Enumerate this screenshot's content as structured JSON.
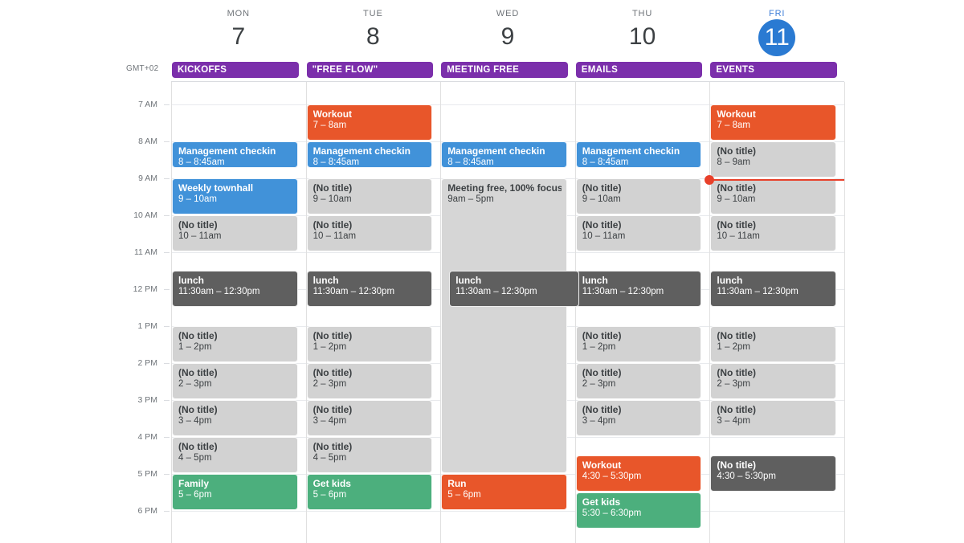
{
  "meta": {
    "timezone_label": "GMT+02",
    "accent_today": "#2a7ad2",
    "allday_chip_color": "#7b2fab",
    "now_indicator_color": "#e8402a"
  },
  "days": [
    {
      "dow": "MON",
      "num": "7",
      "today": false,
      "allday": "KICKOFFS"
    },
    {
      "dow": "TUE",
      "num": "8",
      "today": false,
      "allday": "\"FREE FLOW\""
    },
    {
      "dow": "WED",
      "num": "9",
      "today": false,
      "allday": "MEETING FREE"
    },
    {
      "dow": "THU",
      "num": "10",
      "today": false,
      "allday": "EMAILS"
    },
    {
      "dow": "FRI",
      "num": "11",
      "today": true,
      "allday": "EVENTS"
    }
  ],
  "time_axis": {
    "labels": [
      "7 AM",
      "8 AM",
      "9 AM",
      "10 AM",
      "11 AM",
      "12 PM",
      "1 PM",
      "2 PM",
      "3 PM",
      "4 PM",
      "5 PM",
      "6 PM"
    ]
  },
  "events": [
    {
      "day": 0,
      "title": "Management checkin",
      "time": "8 – 8:45am",
      "color": "blue",
      "start": 8.0,
      "end": 8.75
    },
    {
      "day": 0,
      "title": "Weekly townhall",
      "time": "9 – 10am",
      "color": "blue",
      "start": 9.0,
      "end": 10.0
    },
    {
      "day": 0,
      "title": "(No title)",
      "time": "10 – 11am",
      "color": "gray",
      "start": 10.0,
      "end": 11.0
    },
    {
      "day": 0,
      "title": "lunch",
      "time": "11:30am – 12:30pm",
      "color": "darkgray",
      "start": 11.5,
      "end": 12.5
    },
    {
      "day": 0,
      "title": "(No title)",
      "time": "1 – 2pm",
      "color": "gray",
      "start": 13.0,
      "end": 14.0
    },
    {
      "day": 0,
      "title": "(No title)",
      "time": "2 – 3pm",
      "color": "gray",
      "start": 14.0,
      "end": 15.0
    },
    {
      "day": 0,
      "title": "(No title)",
      "time": "3 – 4pm",
      "color": "gray",
      "start": 15.0,
      "end": 16.0
    },
    {
      "day": 0,
      "title": "(No title)",
      "time": "4 – 5pm",
      "color": "gray",
      "start": 16.0,
      "end": 17.0
    },
    {
      "day": 0,
      "title": "Family",
      "time": "5 – 6pm",
      "color": "green",
      "start": 17.0,
      "end": 18.0
    },
    {
      "day": 1,
      "title": "Workout",
      "time": "7 – 8am",
      "color": "orange",
      "start": 7.0,
      "end": 8.0
    },
    {
      "day": 1,
      "title": "Management checkin",
      "time": "8 – 8:45am",
      "color": "blue",
      "start": 8.0,
      "end": 8.75
    },
    {
      "day": 1,
      "title": "(No title)",
      "time": "9 – 10am",
      "color": "gray",
      "start": 9.0,
      "end": 10.0
    },
    {
      "day": 1,
      "title": "(No title)",
      "time": "10 – 11am",
      "color": "gray",
      "start": 10.0,
      "end": 11.0
    },
    {
      "day": 1,
      "title": "lunch",
      "time": "11:30am – 12:30pm",
      "color": "darkgray",
      "start": 11.5,
      "end": 12.5
    },
    {
      "day": 1,
      "title": "(No title)",
      "time": "1 – 2pm",
      "color": "gray",
      "start": 13.0,
      "end": 14.0
    },
    {
      "day": 1,
      "title": "(No title)",
      "time": "2 – 3pm",
      "color": "gray",
      "start": 14.0,
      "end": 15.0
    },
    {
      "day": 1,
      "title": "(No title)",
      "time": "3 – 4pm",
      "color": "gray",
      "start": 15.0,
      "end": 16.0
    },
    {
      "day": 1,
      "title": "(No title)",
      "time": "4 – 5pm",
      "color": "gray",
      "start": 16.0,
      "end": 17.0
    },
    {
      "day": 1,
      "title": "Get kids",
      "time": "5 – 6pm",
      "color": "green",
      "start": 17.0,
      "end": 18.0
    },
    {
      "day": 2,
      "title": "Management checkin",
      "time": "8 – 8:45am",
      "color": "blue",
      "start": 8.0,
      "end": 8.75
    },
    {
      "day": 2,
      "title": "Meeting free, 100% focus",
      "time": "9am – 5pm",
      "color": "lightgray",
      "start": 9.0,
      "end": 17.0
    },
    {
      "day": 2,
      "title": "lunch",
      "time": "11:30am – 12:30pm",
      "color": "darkgray",
      "start": 11.5,
      "end": 12.5,
      "indent": true
    },
    {
      "day": 2,
      "title": "Run",
      "time": "5 – 6pm",
      "color": "orange",
      "start": 17.0,
      "end": 18.0
    },
    {
      "day": 3,
      "title": "Management checkin",
      "time": "8 – 8:45am",
      "color": "blue",
      "start": 8.0,
      "end": 8.75
    },
    {
      "day": 3,
      "title": "(No title)",
      "time": "9 – 10am",
      "color": "gray",
      "start": 9.0,
      "end": 10.0
    },
    {
      "day": 3,
      "title": "(No title)",
      "time": "10 – 11am",
      "color": "gray",
      "start": 10.0,
      "end": 11.0
    },
    {
      "day": 3,
      "title": "lunch",
      "time": "11:30am – 12:30pm",
      "color": "darkgray",
      "start": 11.5,
      "end": 12.5
    },
    {
      "day": 3,
      "title": "(No title)",
      "time": "1 – 2pm",
      "color": "gray",
      "start": 13.0,
      "end": 14.0
    },
    {
      "day": 3,
      "title": "(No title)",
      "time": "2 – 3pm",
      "color": "gray",
      "start": 14.0,
      "end": 15.0
    },
    {
      "day": 3,
      "title": "(No title)",
      "time": "3 – 4pm",
      "color": "gray",
      "start": 15.0,
      "end": 16.0
    },
    {
      "day": 3,
      "title": "Workout",
      "time": "4:30 – 5:30pm",
      "color": "orange",
      "start": 16.5,
      "end": 17.5
    },
    {
      "day": 3,
      "title": "Get kids",
      "time": "5:30 – 6:30pm",
      "color": "green",
      "start": 17.5,
      "end": 18.5
    },
    {
      "day": 4,
      "title": "Workout",
      "time": "7 – 8am",
      "color": "orange",
      "start": 7.0,
      "end": 8.0
    },
    {
      "day": 4,
      "title": "(No title)",
      "time": "8 – 9am",
      "color": "gray",
      "start": 8.0,
      "end": 9.0
    },
    {
      "day": 4,
      "title": "(No title)",
      "time": "9 – 10am",
      "color": "gray",
      "start": 9.0,
      "end": 10.0
    },
    {
      "day": 4,
      "title": "(No title)",
      "time": "10 – 11am",
      "color": "gray",
      "start": 10.0,
      "end": 11.0
    },
    {
      "day": 4,
      "title": "lunch",
      "time": "11:30am – 12:30pm",
      "color": "darkgray",
      "start": 11.5,
      "end": 12.5
    },
    {
      "day": 4,
      "title": "(No title)",
      "time": "1 – 2pm",
      "color": "gray",
      "start": 13.0,
      "end": 14.0
    },
    {
      "day": 4,
      "title": "(No title)",
      "time": "2 – 3pm",
      "color": "gray",
      "start": 14.0,
      "end": 15.0
    },
    {
      "day": 4,
      "title": "(No title)",
      "time": "3 – 4pm",
      "color": "gray",
      "start": 15.0,
      "end": 16.0
    },
    {
      "day": 4,
      "title": "(No title)",
      "time": "4:30 – 5:30pm",
      "color": "darkgray",
      "start": 16.5,
      "end": 17.5
    }
  ],
  "now_indicator": {
    "day": 4,
    "time": 9.02
  }
}
